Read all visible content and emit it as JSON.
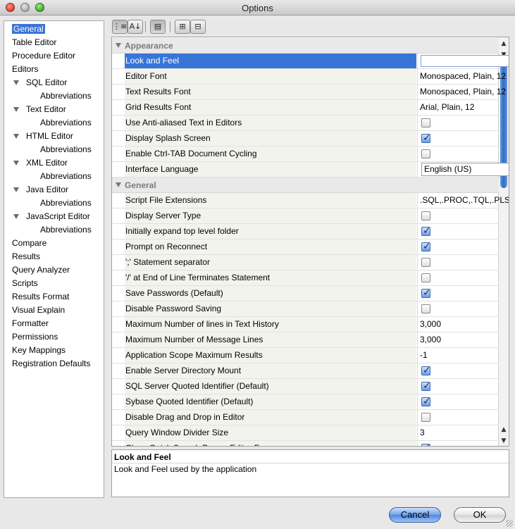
{
  "window": {
    "title": "Options"
  },
  "sidebar": {
    "items": [
      {
        "label": "General",
        "level": 0,
        "selected": true
      },
      {
        "label": "Table Editor",
        "level": 0
      },
      {
        "label": "Procedure Editor",
        "level": 0
      },
      {
        "label": "Editors",
        "level": 0
      },
      {
        "label": "SQL Editor",
        "level": 1,
        "expandable": true
      },
      {
        "label": "Abbreviations",
        "level": 2
      },
      {
        "label": "Text Editor",
        "level": 1,
        "expandable": true
      },
      {
        "label": "Abbreviations",
        "level": 2
      },
      {
        "label": "HTML Editor",
        "level": 1,
        "expandable": true
      },
      {
        "label": "Abbreviations",
        "level": 2
      },
      {
        "label": "XML Editor",
        "level": 1,
        "expandable": true
      },
      {
        "label": "Abbreviations",
        "level": 2
      },
      {
        "label": "Java Editor",
        "level": 1,
        "expandable": true
      },
      {
        "label": "Abbreviations",
        "level": 2
      },
      {
        "label": "JavaScript Editor",
        "level": 1,
        "expandable": true
      },
      {
        "label": "Abbreviations",
        "level": 2
      },
      {
        "label": "Compare",
        "level": 0
      },
      {
        "label": "Results",
        "level": 0
      },
      {
        "label": "Query Analyzer",
        "level": 0
      },
      {
        "label": "Scripts",
        "level": 0
      },
      {
        "label": "Results Format",
        "level": 0
      },
      {
        "label": "Visual Explain",
        "level": 0
      },
      {
        "label": "Formatter",
        "level": 0
      },
      {
        "label": "Permissions",
        "level": 0
      },
      {
        "label": "Key Mappings",
        "level": 0
      },
      {
        "label": "Registration Defaults",
        "level": 0
      }
    ]
  },
  "toolbar": {
    "buttons": [
      {
        "name": "categorized-view-button",
        "glyph": "⋮≡"
      },
      {
        "name": "sort-alphabetical-button",
        "glyph": "A↓"
      },
      {
        "name": "show-description-button",
        "glyph": "▤"
      },
      {
        "name": "expand-all-button",
        "glyph": "⊞"
      },
      {
        "name": "collapse-all-button",
        "glyph": "⊟"
      }
    ]
  },
  "properties": {
    "rows": [
      {
        "type": "category",
        "label": "Appearance"
      },
      {
        "label": "Look and Feel",
        "kind": "edit",
        "value": "",
        "selected": true
      },
      {
        "label": "Editor Font",
        "kind": "text",
        "value": "Monospaced, Plain, 12"
      },
      {
        "label": "Text Results Font",
        "kind": "text",
        "value": "Monospaced, Plain, 12"
      },
      {
        "label": "Grid Results Font",
        "kind": "text",
        "value": "Arial, Plain, 12"
      },
      {
        "label": "Use Anti-aliased Text in Editors",
        "kind": "check",
        "checked": false
      },
      {
        "label": "Display Splash Screen",
        "kind": "check",
        "checked": true
      },
      {
        "label": "Enable Ctrl-TAB Document Cycling",
        "kind": "check",
        "checked": false
      },
      {
        "label": "Interface Language",
        "kind": "combo",
        "value": "English (US)"
      },
      {
        "type": "category",
        "label": "General"
      },
      {
        "label": "Script File Extensions",
        "kind": "text",
        "value": ".SQL,.PROC,.TQL,.PLSQL,.PKS,.PKB,.XQB,.TX..."
      },
      {
        "label": "Display Server Type",
        "kind": "check",
        "checked": false
      },
      {
        "label": "Initially expand top level folder",
        "kind": "check",
        "checked": true
      },
      {
        "label": "Prompt on Reconnect",
        "kind": "check",
        "checked": true
      },
      {
        "label": "';' Statement separator",
        "kind": "check",
        "checked": false
      },
      {
        "label": "'/' at End of Line Terminates Statement",
        "kind": "check",
        "checked": false
      },
      {
        "label": "Save Passwords (Default)",
        "kind": "check",
        "checked": true
      },
      {
        "label": "Disable Password Saving",
        "kind": "check",
        "checked": false
      },
      {
        "label": "Maximum Number of lines in Text History",
        "kind": "text",
        "value": "3,000"
      },
      {
        "label": "Maximum Number of Message Lines",
        "kind": "text",
        "value": "3,000"
      },
      {
        "label": "Application Scope Maximum Results",
        "kind": "text",
        "value": "-1"
      },
      {
        "label": "Enable Server Directory Mount",
        "kind": "check",
        "checked": true
      },
      {
        "label": "SQL Server Quoted Identifier (Default)",
        "kind": "check",
        "checked": true
      },
      {
        "label": "Sybase Quoted Identifier (Default)",
        "kind": "check",
        "checked": true
      },
      {
        "label": "Disable Drag and Drop in Editor",
        "kind": "check",
        "checked": false
      },
      {
        "label": "Query Window Divider Size",
        "kind": "text",
        "value": "3"
      },
      {
        "label": "Close Quick Search Bar on Editor Focus",
        "kind": "check",
        "checked": true
      }
    ]
  },
  "description": {
    "title": "Look and Feel",
    "text": "Look and Feel used by the application"
  },
  "buttons": {
    "cancel": "Cancel",
    "ok": "OK"
  },
  "colors": {
    "selection": "#3875d7",
    "checkbox_checked": "#6b9ce6"
  }
}
